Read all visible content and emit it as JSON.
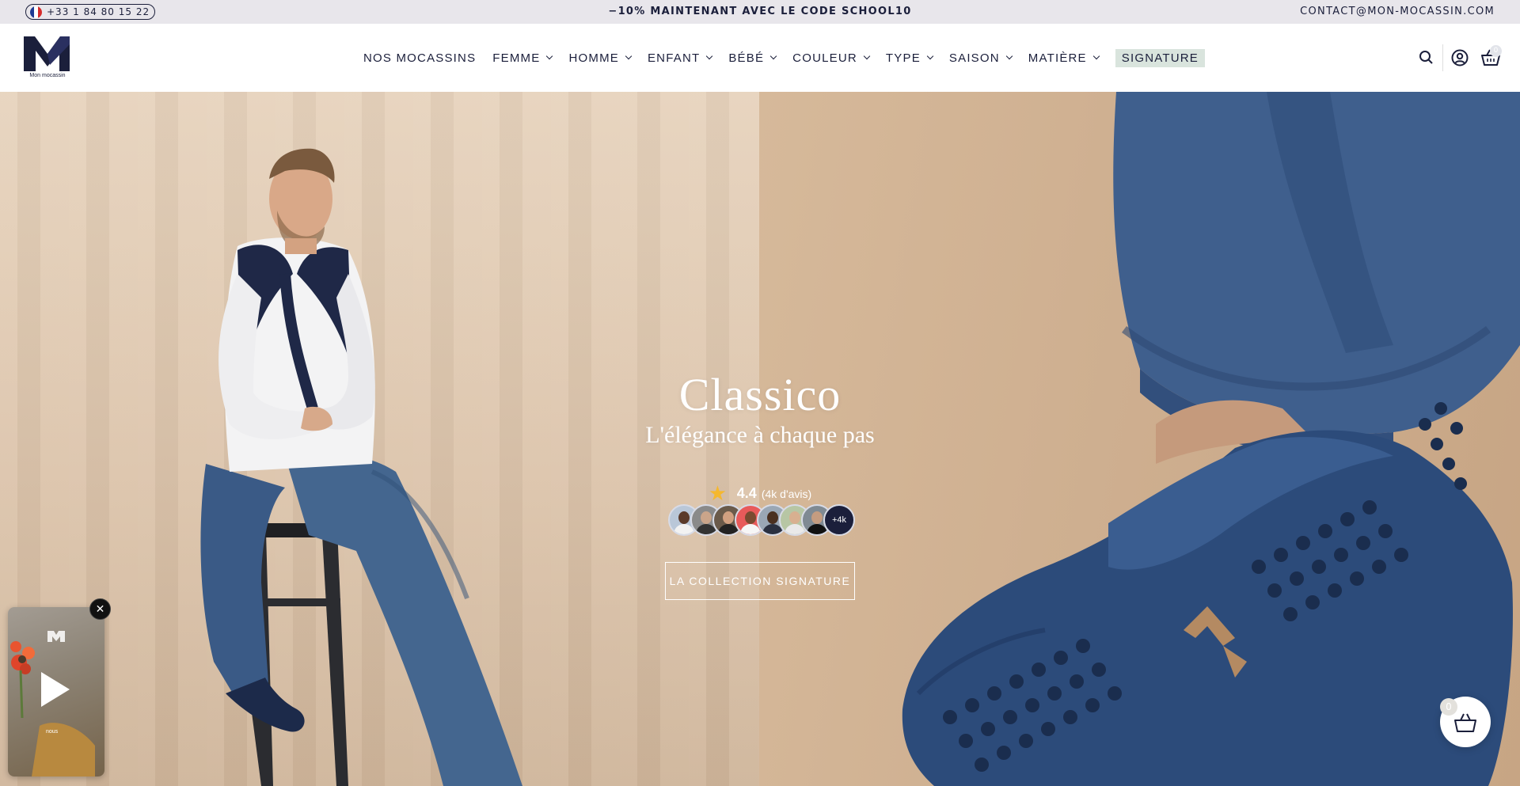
{
  "announcement": {
    "phone": "+33 1 84 80 15 22",
    "promo": "−10% MAINTENANT AVEC LE CODE SCHOOL10",
    "email": "CONTACT@MON-MOCASSIN.COM"
  },
  "header": {
    "logo_text": "Mon mocassin",
    "nav": [
      {
        "label": "NOS MOCASSINS"
      },
      {
        "label": "FEMME"
      },
      {
        "label": "HOMME"
      },
      {
        "label": "ENFANT"
      },
      {
        "label": "BÉBÉ"
      },
      {
        "label": "COULEUR"
      },
      {
        "label": "TYPE"
      },
      {
        "label": "SAISON"
      },
      {
        "label": "MATIÈRE"
      },
      {
        "label": "SIGNATURE"
      }
    ],
    "cart_count": "0",
    "icons": [
      "search-icon",
      "account-icon",
      "basket-icon"
    ]
  },
  "hero": {
    "title": "Classico",
    "subtitle": "L'élégance à chaque pas",
    "rating_value": "4.4",
    "rating_count": "(4k d'avis)",
    "avatars_more": "+4k",
    "cta": "LA COLLECTION SIGNATURE"
  },
  "video_widget": {
    "caption": "nous",
    "close": "✕"
  },
  "floating_cart": {
    "count": "0"
  },
  "colors": {
    "brand_navy": "#1b1f3b",
    "topbar_bg": "#e8e6eb",
    "signature_bg": "#d9e4dd",
    "star": "#f5b82e"
  }
}
